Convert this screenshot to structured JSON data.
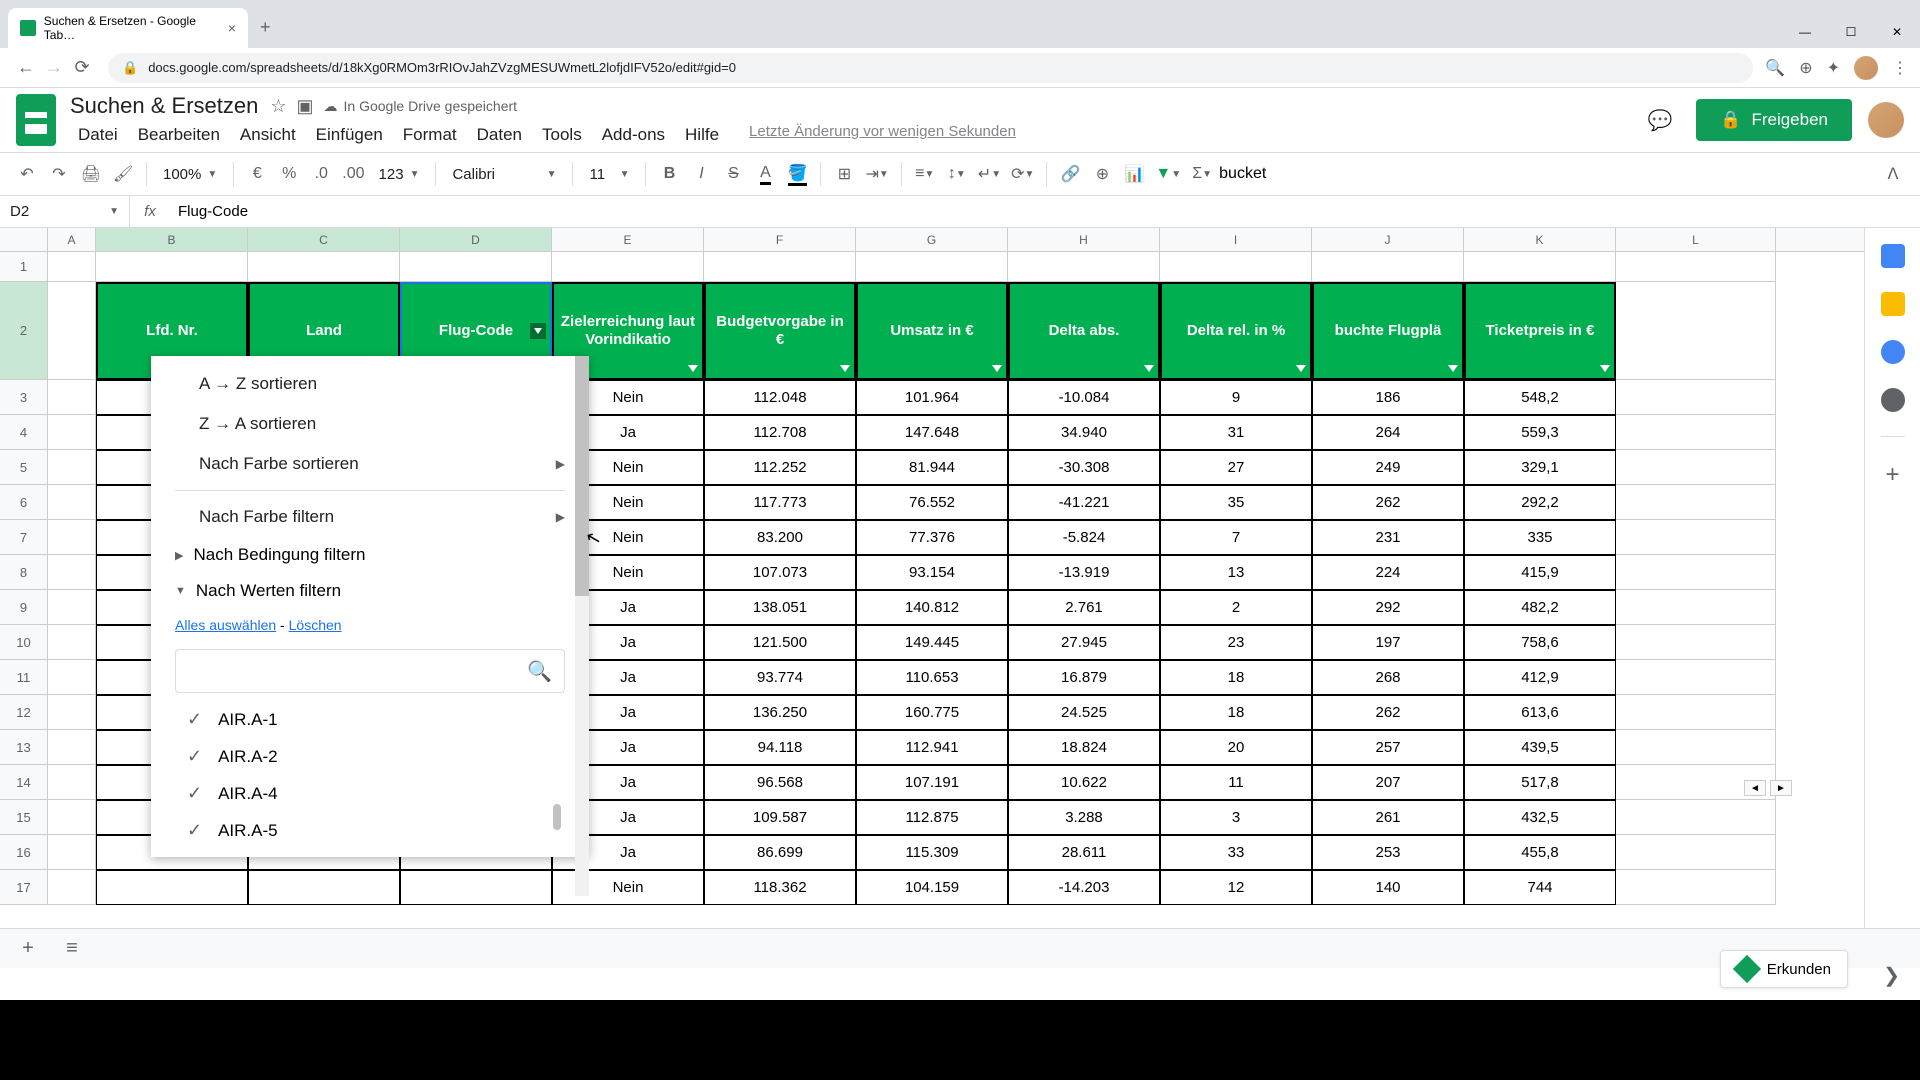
{
  "browser": {
    "tab_title": "Suchen & Ersetzen - Google Tab…",
    "url": "docs.google.com/spreadsheets/d/18kXg0RMOm3rRIOvJahZVzgMESUWmetL2lofjdIFV52o/edit#gid=0"
  },
  "doc": {
    "title": "Suchen & Ersetzen",
    "saved": "In Google Drive gespeichert",
    "last_change": "Letzte Änderung vor wenigen Sekunden"
  },
  "menu": [
    "Datei",
    "Bearbeiten",
    "Ansicht",
    "Einfügen",
    "Format",
    "Daten",
    "Tools",
    "Add-ons",
    "Hilfe"
  ],
  "toolbar": {
    "zoom": "100%",
    "font": "Calibri",
    "size": "11"
  },
  "share_label": "Freigeben",
  "name_box": "D2",
  "formula": "Flug-Code",
  "columns": [
    "A",
    "B",
    "C",
    "D",
    "E",
    "F",
    "G",
    "H",
    "I",
    "J",
    "K",
    "L"
  ],
  "selected_col_idx": [
    1,
    2,
    3
  ],
  "row_numbers": [
    1,
    2,
    3,
    4,
    5,
    6,
    7,
    8,
    9,
    10,
    11,
    12,
    13,
    14,
    15,
    16,
    17
  ],
  "headers": [
    "Lfd. Nr.",
    "Land",
    "Flug-Code",
    "Zielerreichung laut Vorindikatio",
    "Budgetvorgabe in €",
    "Umsatz in €",
    "Delta abs.",
    "Delta rel. in %",
    "buchte Flugplä",
    "Ticketpreis in €"
  ],
  "data_rows": [
    {
      "E": "Nein",
      "F": "112.048",
      "G": "101.964",
      "H": "-10.084",
      "I": "9",
      "J": "186",
      "K": "548,2"
    },
    {
      "E": "Ja",
      "F": "112.708",
      "G": "147.648",
      "H": "34.940",
      "I": "31",
      "J": "264",
      "K": "559,3"
    },
    {
      "E": "Nein",
      "F": "112.252",
      "G": "81.944",
      "H": "-30.308",
      "I": "27",
      "J": "249",
      "K": "329,1"
    },
    {
      "E": "Nein",
      "F": "117.773",
      "G": "76.552",
      "H": "-41.221",
      "I": "35",
      "J": "262",
      "K": "292,2"
    },
    {
      "E": "Nein",
      "F": "83.200",
      "G": "77.376",
      "H": "-5.824",
      "I": "7",
      "J": "231",
      "K": "335"
    },
    {
      "E": "Nein",
      "F": "107.073",
      "G": "93.154",
      "H": "-13.919",
      "I": "13",
      "J": "224",
      "K": "415,9"
    },
    {
      "E": "Ja",
      "F": "138.051",
      "G": "140.812",
      "H": "2.761",
      "I": "2",
      "J": "292",
      "K": "482,2"
    },
    {
      "E": "Ja",
      "F": "121.500",
      "G": "149.445",
      "H": "27.945",
      "I": "23",
      "J": "197",
      "K": "758,6"
    },
    {
      "E": "Ja",
      "F": "93.774",
      "G": "110.653",
      "H": "16.879",
      "I": "18",
      "J": "268",
      "K": "412,9"
    },
    {
      "E": "Ja",
      "F": "136.250",
      "G": "160.775",
      "H": "24.525",
      "I": "18",
      "J": "262",
      "K": "613,6"
    },
    {
      "E": "Ja",
      "F": "94.118",
      "G": "112.941",
      "H": "18.824",
      "I": "20",
      "J": "257",
      "K": "439,5"
    },
    {
      "E": "Ja",
      "F": "96.568",
      "G": "107.191",
      "H": "10.622",
      "I": "11",
      "J": "207",
      "K": "517,8"
    },
    {
      "E": "Ja",
      "F": "109.587",
      "G": "112.875",
      "H": "3.288",
      "I": "3",
      "J": "261",
      "K": "432,5"
    },
    {
      "E": "Ja",
      "F": "86.699",
      "G": "115.309",
      "H": "28.611",
      "I": "33",
      "J": "253",
      "K": "455,8"
    },
    {
      "E": "Nein",
      "F": "118.362",
      "G": "104.159",
      "H": "-14.203",
      "I": "12",
      "J": "140",
      "K": "744"
    }
  ],
  "filter_menu": {
    "sort_az": "A → Z sortieren",
    "sort_za": "Z → A sortieren",
    "sort_by_color": "Nach Farbe sortieren",
    "filter_by_color": "Nach Farbe filtern",
    "filter_by_condition": "Nach Bedingung filtern",
    "filter_by_values": "Nach Werten filtern",
    "select_all": "Alles auswählen",
    "clear": "Löschen",
    "sep": " - ",
    "values": [
      "AIR.A-1",
      "AIR.A-2",
      "AIR.A-4",
      "AIR.A-5"
    ]
  },
  "explore_label": "Erkunden"
}
